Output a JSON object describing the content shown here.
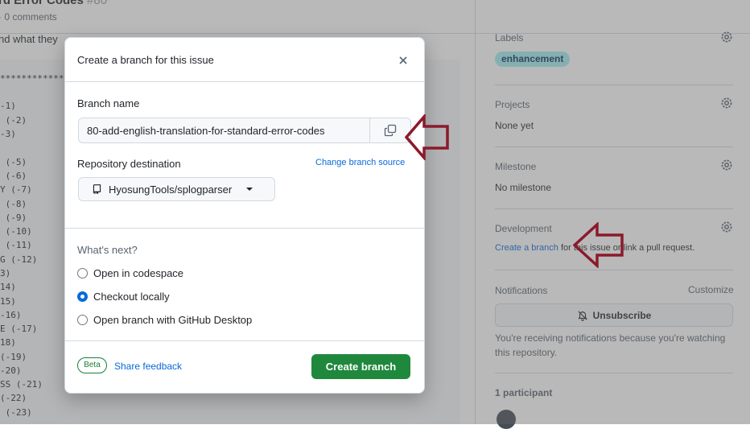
{
  "issue": {
    "title": "rd Error Codes",
    "number": "#80",
    "meta": "· 0 comments",
    "description_fragment": "nd what they"
  },
  "code_lines": [
    "*************",
    "-1)",
    " (-2)",
    "-3)",
    " (-5)",
    " (-6)",
    "Y (-7)",
    " (-8)",
    " (-9)",
    " (-10)",
    " (-11)",
    "G (-12)",
    "3)",
    "14)",
    "15)",
    "-16)",
    "E (-17)",
    "18)",
    "(-19)",
    "-20)",
    "SS (-21)",
    "(-22)",
    " (-23)"
  ],
  "sidebar": {
    "labels": {
      "heading": "Labels",
      "items": [
        "enhancement"
      ]
    },
    "projects": {
      "heading": "Projects",
      "value": "None yet"
    },
    "milestone": {
      "heading": "Milestone",
      "value": "No milestone"
    },
    "development": {
      "heading": "Development",
      "link_text": "Create a branch",
      "rest_text": " for this issue or link a pull request."
    },
    "notifications": {
      "heading": "Notifications",
      "customize": "Customize",
      "unsubscribe_label": "Unsubscribe",
      "note": "You're receiving notifications because you're watching this repository."
    },
    "participants": {
      "heading": "1 participant"
    }
  },
  "dialog": {
    "title": "Create a branch for this issue",
    "branch_name_label": "Branch name",
    "branch_name_value": "80-add-english-translation-for-standard-error-codes",
    "repo_destination_label": "Repository destination",
    "change_source_link": "Change branch source",
    "repo_value": "HyosungTools/splogparser",
    "whats_next": "What's next?",
    "options": [
      {
        "label": "Open in codespace",
        "checked": false
      },
      {
        "label": "Checkout locally",
        "checked": true
      },
      {
        "label": "Open branch with GitHub Desktop",
        "checked": false
      }
    ],
    "beta_badge": "Beta",
    "share_feedback": "Share feedback",
    "create_button": "Create branch"
  },
  "colors": {
    "accent_blue": "#0969da",
    "primary_green": "#1f883d",
    "label_bg": "#a2eeef",
    "annotation_arrow": "#8b1a2b"
  },
  "icons": [
    "close-icon",
    "copy-icon",
    "repo-icon",
    "caret-down-icon",
    "gear-icon",
    "bell-slash-icon"
  ]
}
